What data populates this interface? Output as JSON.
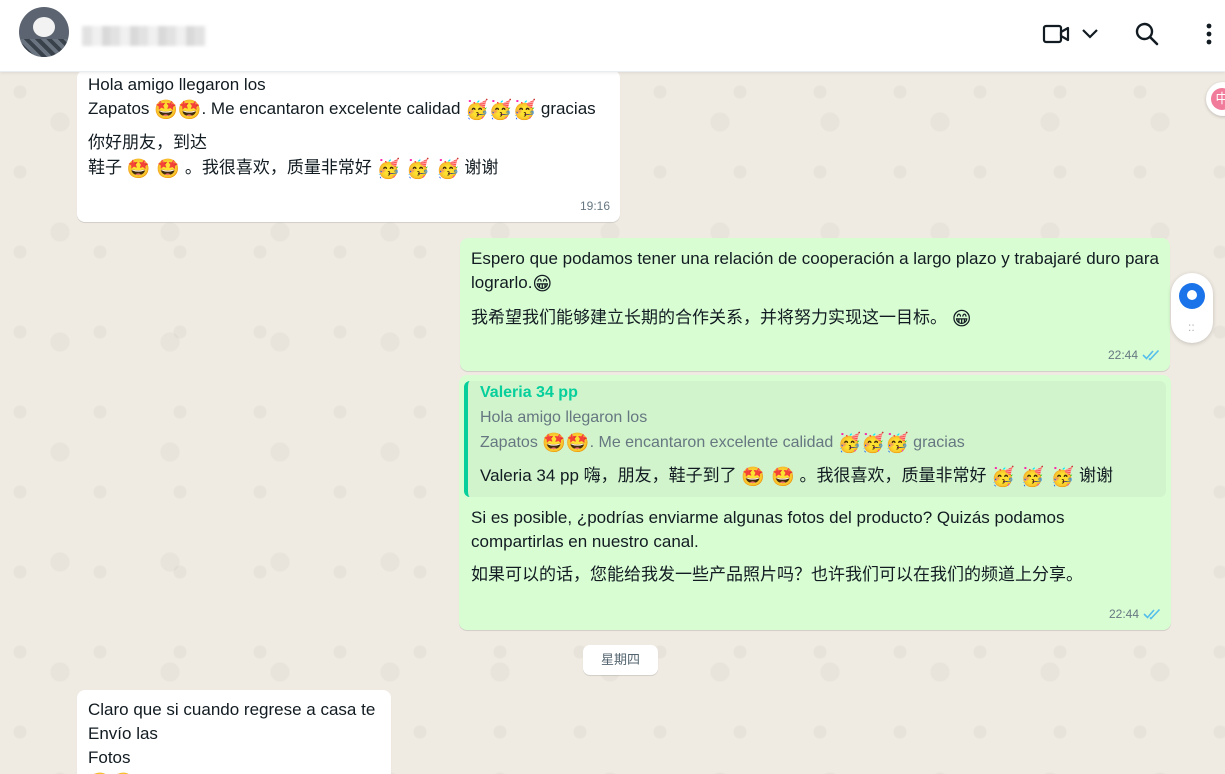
{
  "header": {
    "contact_name": "",
    "icons": [
      "video-call-icon",
      "chevron-down-icon",
      "search-icon",
      "menu-icon"
    ]
  },
  "messages": [
    {
      "id": "m1",
      "direction": "incoming",
      "line1": "Hola amigo llegaron los",
      "line2_pre": "Zapatos ",
      "line2_mid": ". Me encantaron excelente calidad ",
      "line2_post": " gracias",
      "cn_line1": "你好朋友，到达",
      "cn_line2_pre": "鞋子 ",
      "cn_line2_mid": " 。我很喜欢，质量非常好 ",
      "cn_line2_post": " 谢谢",
      "emoji_star": "🤩🤩",
      "emoji_party": "🥳🥳🥳",
      "emoji_star_spaced": "🤩 🤩",
      "emoji_party_spaced": "🥳 🥳 🥳",
      "time": "19:16"
    },
    {
      "id": "m2",
      "direction": "outgoing",
      "text": "Espero que podamos tener una relación de cooperación a largo plazo y trabajaré duro para lograrlo.",
      "emoji": "😁",
      "cn_text": "我希望我们能够建立长期的合作关系，并将努力实现这一目标。 ",
      "time": "22:44",
      "status": "read"
    },
    {
      "id": "m3",
      "direction": "outgoing",
      "quote_author": "Valeria 34 pp",
      "quote_line1": "Hola amigo llegaron los",
      "quote_line2_pre": "Zapatos ",
      "quote_line2_mid": ". Me encantaron excelente calidad ",
      "quote_line2_post": " gracias",
      "quote_reply_pre": "Valeria 34 pp 嗨，朋友，鞋子到了 ",
      "quote_reply_mid": " 。我很喜欢，质量非常好 ",
      "quote_reply_post": " 谢谢",
      "text": "Si es posible, ¿podrías enviarme algunas fotos del producto? Quizás podamos compartirlas en nuestro canal.",
      "cn_text": "如果可以的话，您能给我发一些产品照片吗？也许我们可以在我们的频道上分享。",
      "time": "22:44",
      "status": "read"
    },
    {
      "id": "m4",
      "direction": "incoming",
      "text": "Claro que si cuando  regrese a casa te\nEnvío las\nFotos",
      "emoji": "🤩🤩"
    }
  ],
  "date_divider": "星期四",
  "side_widget": {
    "grip": "::"
  },
  "corner_badge": "中",
  "colors": {
    "chat_bg": "#efeae2",
    "incoming_bubble": "#ffffff",
    "outgoing_bubble": "#d9fdd3",
    "quote_accent": "#06cf9c",
    "read_ticks": "#53bdeb"
  }
}
